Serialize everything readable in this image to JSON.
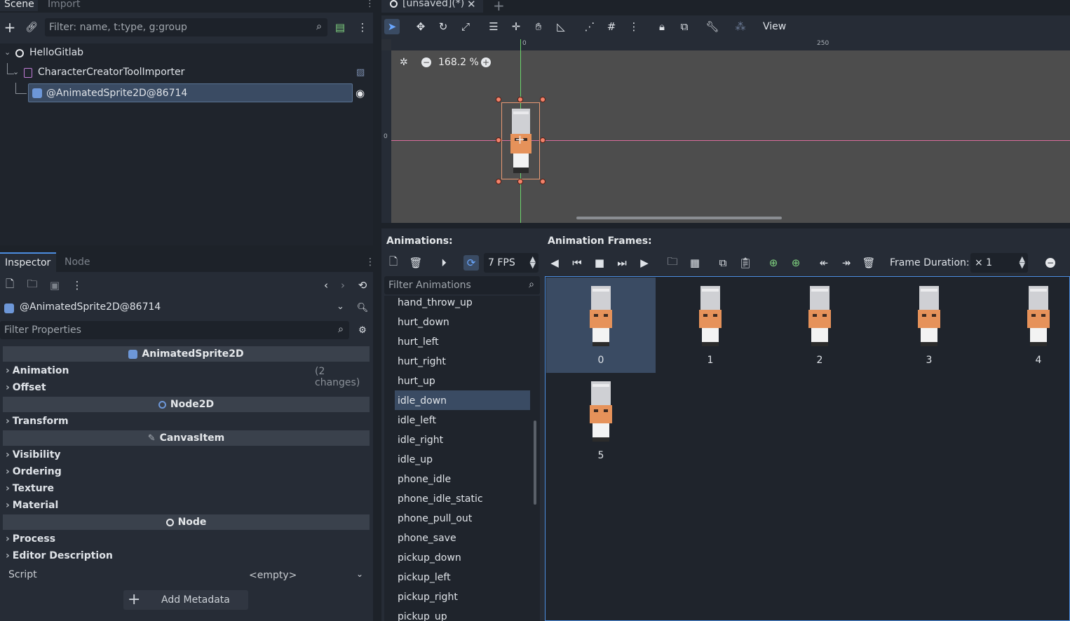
{
  "left_dock": {
    "tabs": [
      "Scene",
      "Import"
    ],
    "filter_placeholder": "Filter: name, t:type, g:group",
    "tree": [
      {
        "label": "HelloGitlab"
      },
      {
        "label": "CharacterCreatorToolImporter"
      },
      {
        "label": "@AnimatedSprite2D@86714"
      }
    ]
  },
  "inspector": {
    "tabs": [
      "Inspector",
      "Node"
    ],
    "object_name": "@AnimatedSprite2D@86714",
    "filter_placeholder": "Filter Properties",
    "sections": [
      "AnimatedSprite2D",
      "Node2D",
      "CanvasItem",
      "Node"
    ],
    "groups": {
      "animation": "Animation",
      "animation_changes": "(2 changes)",
      "offset": "Offset",
      "transform": "Transform",
      "visibility": "Visibility",
      "ordering": "Ordering",
      "texture": "Texture",
      "material": "Material",
      "process": "Process",
      "editor_description": "Editor Description"
    },
    "script_label": "Script",
    "script_value": "<empty>",
    "add_metadata": "Add Metadata"
  },
  "editor": {
    "tab_title": "[unsaved](*)",
    "view_menu": "View",
    "zoom": "168.2 %",
    "ruler": {
      "zero": "0",
      "mark": "250",
      "v_zero": "0"
    }
  },
  "sprite_frames": {
    "animations_label": "Animations:",
    "frames_label": "Animation Frames:",
    "fps": "7 FPS",
    "frame_duration_label": "Frame Duration:",
    "frame_duration_value": "× 1",
    "filter_placeholder": "Filter Animations",
    "animations": [
      "hand_throw_up",
      "hurt_down",
      "hurt_left",
      "hurt_right",
      "hurt_up",
      "idle_down",
      "idle_left",
      "idle_right",
      "idle_up",
      "phone_idle",
      "phone_idle_static",
      "phone_pull_out",
      "phone_save",
      "pickup_down",
      "pickup_left",
      "pickup_right",
      "pickup_up"
    ],
    "selected_animation": "idle_down",
    "frames": [
      "0",
      "1",
      "2",
      "3",
      "4",
      "5"
    ]
  },
  "colors": {
    "accent": "#4c8de0",
    "selection": "#3a4b63",
    "bg": "#262c36"
  }
}
